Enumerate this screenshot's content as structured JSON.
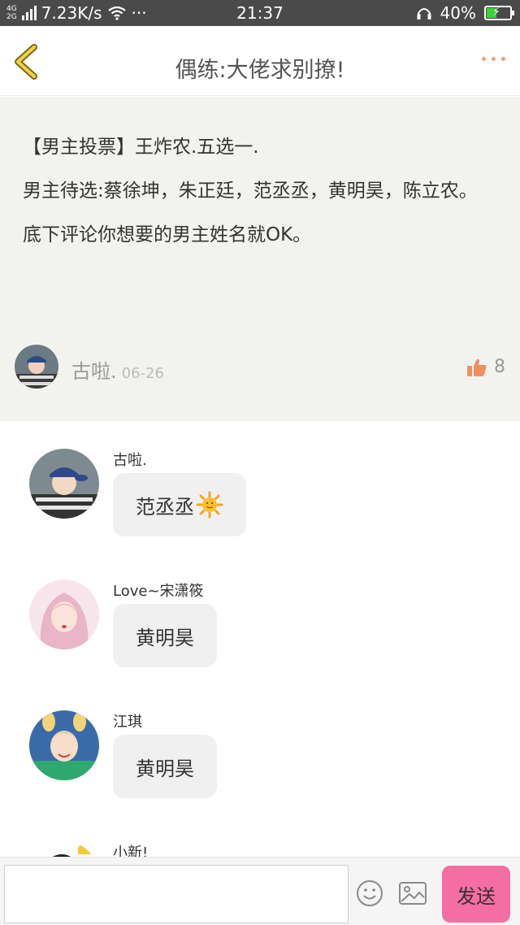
{
  "status_bar": {
    "net_top": "4G",
    "net_bottom": "2G",
    "speed": "7.23K/s",
    "more": "···",
    "time": "21:37",
    "battery": "40%",
    "battery_level": 0.4,
    "battery_color": "#3ad13a"
  },
  "nav": {
    "title": "偶练:大佬求别撩!",
    "accent_color": "#f0a070"
  },
  "post": {
    "lines": [
      "【男主投票】王炸农.五选一.",
      "男主待选:蔡徐坤，朱正廷，范丞丞，黄明昊，陈立农。",
      "底下评论你想要的男主姓名就OK。"
    ],
    "author": "古啦.",
    "date": "06-26",
    "likes": "8"
  },
  "comments": [
    {
      "name": "古啦.",
      "text": "范丞丞",
      "has_sun": true
    },
    {
      "name": "Love~宋潇筱",
      "text": "黄明昊",
      "has_sun": false
    },
    {
      "name": "江琪",
      "text": "黄明昊",
      "has_sun": false
    },
    {
      "name": "小新!",
      "text": "",
      "has_sun": false
    }
  ],
  "input_bar": {
    "value": "",
    "send_label": "发送",
    "send_color": "#f46ea2"
  }
}
